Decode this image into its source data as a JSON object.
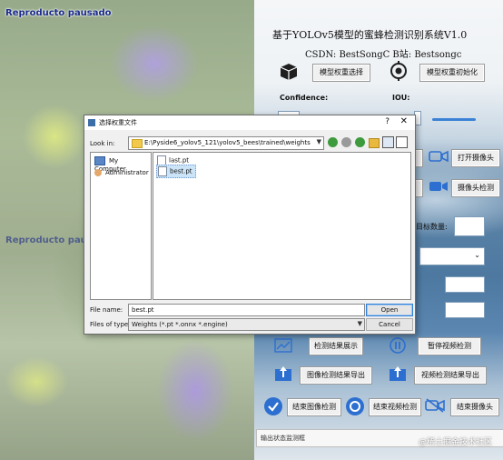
{
  "video": {
    "label_top": "Reproducto pausado",
    "label_bottom": "Reproducto pausado"
  },
  "app": {
    "title": "基于YOLOv5模型的蜜蜂检测识别系统V1.0",
    "subtitle": "CSDN:  BestSongC   B站:  Bestsongc",
    "select_weights_label": "模型权重选择",
    "init_weights_label": "模型权重初始化",
    "confidence_label": "Confidence:",
    "iou_label": "IOU:",
    "open_camera_label": "打开摄像头",
    "camera_detect_label": "摄像头检测",
    "target_count_label": "目标数量:",
    "show_results_label": "检测结果展示",
    "pause_video_label": "暂停视频检测",
    "export_image_label": "图像检测结果导出",
    "export_video_label": "视频检测结果导出",
    "end_image_label": "结束图像检测",
    "end_video_label": "结束视频检测",
    "end_camera_label": "结束摄像头",
    "status_label": "输出状态监测框",
    "watermark": "@稀土掘金技术社区",
    "accent_color": "#3b82d6"
  },
  "dialog": {
    "title": "选择权重文件",
    "help": "?",
    "close": "✕",
    "look_in_label": "Look in:",
    "look_in_path": "E:\\Pyside6_yolov5_121\\yolov5_bees\\trained\\weights",
    "sidebar": [
      {
        "label": "My Computer",
        "icon": "computer-icon"
      },
      {
        "label": "Administrator",
        "icon": "user-icon"
      }
    ],
    "files": [
      {
        "name": "last.pt",
        "selected": false
      },
      {
        "name": "best.pt",
        "selected": true
      }
    ],
    "file_name_label": "File name:",
    "file_name_value": "best.pt",
    "file_type_label": "Files of type:",
    "file_type_value": "Weights (*.pt *.onnx *.engine)",
    "open_label": "Open",
    "cancel_label": "Cancel"
  }
}
